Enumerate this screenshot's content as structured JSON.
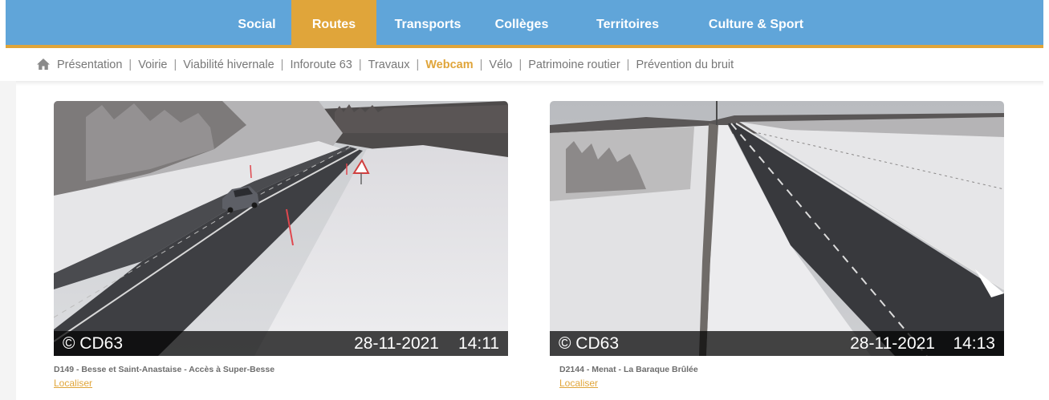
{
  "topnav": {
    "tabs": [
      {
        "label": "Social"
      },
      {
        "label": "Routes",
        "active": true
      },
      {
        "label": "Transports"
      },
      {
        "label": "Collèges"
      },
      {
        "label": "Territoires"
      },
      {
        "label": "Culture & Sport"
      }
    ]
  },
  "subnav": {
    "items": [
      {
        "label": "Présentation"
      },
      {
        "label": "Voirie"
      },
      {
        "label": "Viabilité hivernale"
      },
      {
        "label": "Inforoute 63"
      },
      {
        "label": "Travaux"
      },
      {
        "label": "Webcam",
        "active": true
      },
      {
        "label": "Vélo"
      },
      {
        "label": "Patrimoine routier"
      },
      {
        "label": "Prévention du bruit"
      }
    ],
    "separator": "|"
  },
  "webcams": [
    {
      "copyright": "© CD63",
      "date": "28-11-2021",
      "time": "14:11",
      "caption": "D149 - Besse et Saint-Anastaise - Accès à Super-Besse",
      "link": "Localiser"
    },
    {
      "copyright": "© CD63",
      "date": "28-11-2021",
      "time": "14:13",
      "caption": "D2144 - Menat - La Baraque Brûlée",
      "link": "Localiser"
    }
  ],
  "colors": {
    "nav_blue": "#60a5d9",
    "accent_gold": "#e0a53a",
    "subnav_text": "#777777"
  }
}
